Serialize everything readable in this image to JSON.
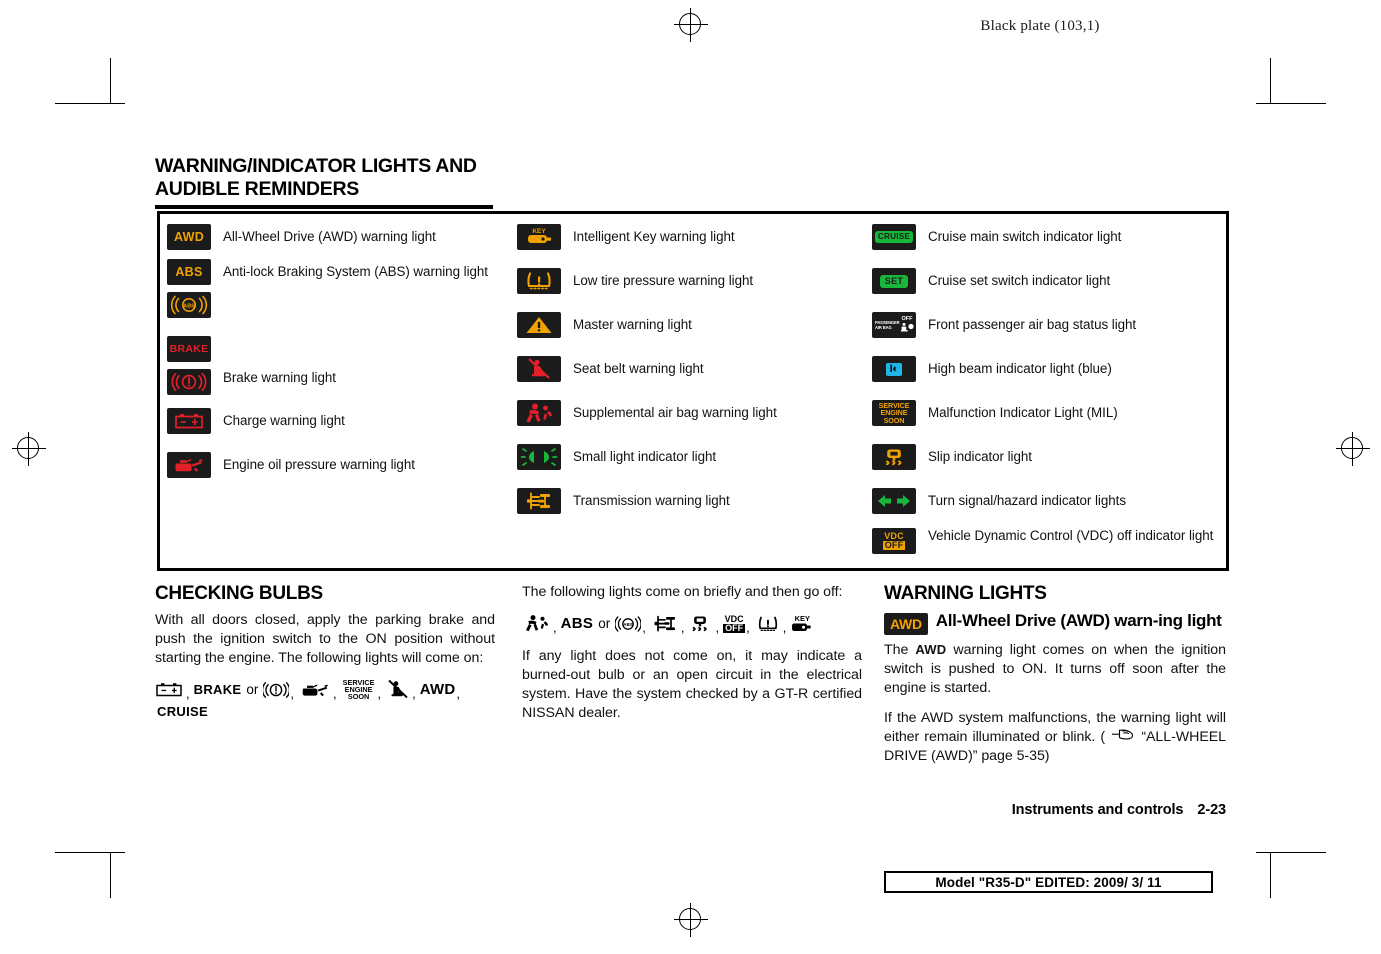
{
  "header": {
    "black_plate": "Black plate (103,1)"
  },
  "section": {
    "title_line1": "WARNING/INDICATOR LIGHTS AND",
    "title_line2": "AUDIBLE REMINDERS"
  },
  "table": {
    "column1": [
      {
        "icons": [
          "awd"
        ],
        "label": "All-Wheel Drive (AWD) warning light"
      },
      {
        "icons": [
          "abs-text",
          "abs-ring"
        ],
        "label": "Anti-lock Braking System (ABS) warning light"
      },
      {
        "icons": [
          "brake-text",
          "brake-circle"
        ],
        "label": "Brake warning light"
      },
      {
        "icons": [
          "battery"
        ],
        "label": "Charge warning light"
      },
      {
        "icons": [
          "oil-can"
        ],
        "label": "Engine oil pressure warning light"
      }
    ],
    "column2": [
      {
        "icons": [
          "key"
        ],
        "label": "Intelligent Key warning light"
      },
      {
        "icons": [
          "tire-pressure"
        ],
        "label": "Low tire pressure warning light"
      },
      {
        "icons": [
          "master-warning"
        ],
        "label": "Master warning light"
      },
      {
        "icons": [
          "seat-belt"
        ],
        "label": "Seat belt warning light"
      },
      {
        "icons": [
          "air-bag"
        ],
        "label": "Supplemental air bag warning light"
      },
      {
        "icons": [
          "small-light"
        ],
        "label": "Small light indicator light"
      },
      {
        "icons": [
          "transmission"
        ],
        "label": "Transmission warning light"
      }
    ],
    "column3": [
      {
        "icons": [
          "cruise"
        ],
        "label": "Cruise main switch indicator light"
      },
      {
        "icons": [
          "set"
        ],
        "label": "Cruise set switch indicator light"
      },
      {
        "icons": [
          "passenger-air-bag"
        ],
        "label": "Front passenger air bag status light"
      },
      {
        "icons": [
          "high-beam"
        ],
        "label": "High beam indicator light (blue)"
      },
      {
        "icons": [
          "service-engine-soon"
        ],
        "label": "Malfunction Indicator Light (MIL)"
      },
      {
        "icons": [
          "slip"
        ],
        "label": "Slip indicator light"
      },
      {
        "icons": [
          "turn-signal"
        ],
        "label": "Turn signal/hazard indicator lights"
      },
      {
        "icons": [
          "vdc-off"
        ],
        "label": "Vehicle Dynamic Control (VDC) off indicator light"
      }
    ]
  },
  "checking_bulbs": {
    "heading": "CHECKING BULBS",
    "paragraph": "With all doors closed, apply the parking brake and push the ignition switch to the ON position without starting the engine. The following lights will come on:",
    "strip_or": "or",
    "strip_brake": "BRAKE",
    "strip_awd": "AWD",
    "strip_cruise": "CRUISE",
    "strip_ses_l1": "SERVICE",
    "strip_ses_l2": "ENGINE",
    "strip_ses_l3": "SOON",
    "comma": ","
  },
  "brief_lights": {
    "paragraph": "The following lights come on briefly and then go off:",
    "strip_abs": "ABS",
    "strip_or": "or",
    "strip_vdc1": "VDC",
    "strip_vdc2": "OFF",
    "strip_key": "KEY",
    "paragraph2": "If any light does not come on, it may indicate a burned-out bulb or an open circuit in the electrical system. Have the system checked by a GT-R certified NISSAN dealer."
  },
  "warning_lights": {
    "heading": "WARNING LIGHTS",
    "chip_label": "AWD",
    "subheading": "All-Wheel Drive (AWD) warn-ing light",
    "paragraph1_a": "The",
    "paragraph1_icon": "AWD",
    "paragraph1_b": "warning light comes on when the ignition switch is pushed to ON. It turns off soon after the engine is started.",
    "paragraph2_a": "If the AWD system malfunctions, the warning light will either remain illuminated or blink. (",
    "paragraph2_b": "“ALL-WHEEL DRIVE (AWD)” page 5-35)"
  },
  "footer": {
    "chapter": "Instruments and controls",
    "page": "2-23",
    "model_box": "Model \"R35-D\"  EDITED:  2009/ 3/ 11"
  },
  "colors": {
    "amber": "#f0a202",
    "red": "#e3202a",
    "green": "#19b63c",
    "blue": "#21b5e8",
    "chip_bg": "#1b1b1b"
  }
}
